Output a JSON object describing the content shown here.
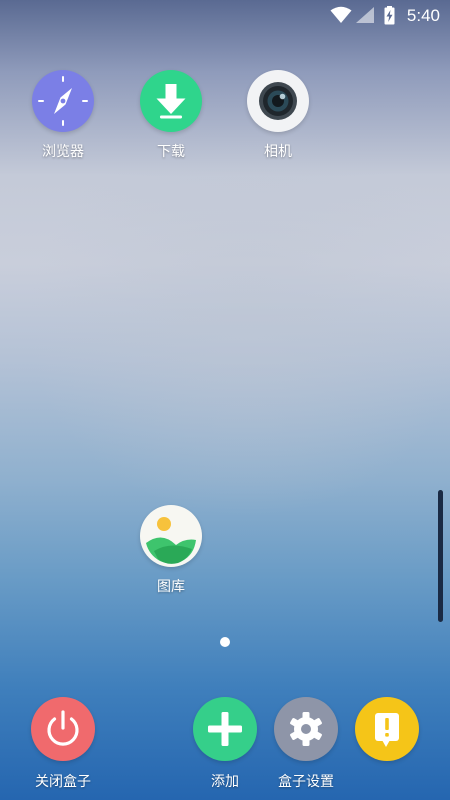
{
  "status_bar": {
    "time": "5:40",
    "icons": [
      "wifi-icon",
      "cellular-signal-icon",
      "battery-charging-icon"
    ]
  },
  "home_apps": [
    {
      "label": "浏览器",
      "icon": "compass-icon",
      "color": "#7b7fe6"
    },
    {
      "label": "下载",
      "icon": "download-arrow-icon",
      "color": "#2fd58c"
    },
    {
      "label": "相机",
      "icon": "camera-lens-icon",
      "color": "#f2f3f5"
    },
    {
      "label": "图库",
      "icon": "landscape-photo-icon",
      "color": "#f7f7f2"
    }
  ],
  "page_indicator": {
    "pages": 1,
    "current": 1
  },
  "dock": [
    {
      "label": "关闭盒子",
      "icon": "power-icon",
      "color": "#f06a6d"
    },
    {
      "label": "添加",
      "icon": "plus-icon",
      "color": "#35cf8a"
    },
    {
      "label": "盒子设置",
      "icon": "gear-icon",
      "color": "#8e95a8"
    },
    {
      "label": "",
      "icon": "exclamation-icon",
      "color": "#f5c518"
    }
  ]
}
